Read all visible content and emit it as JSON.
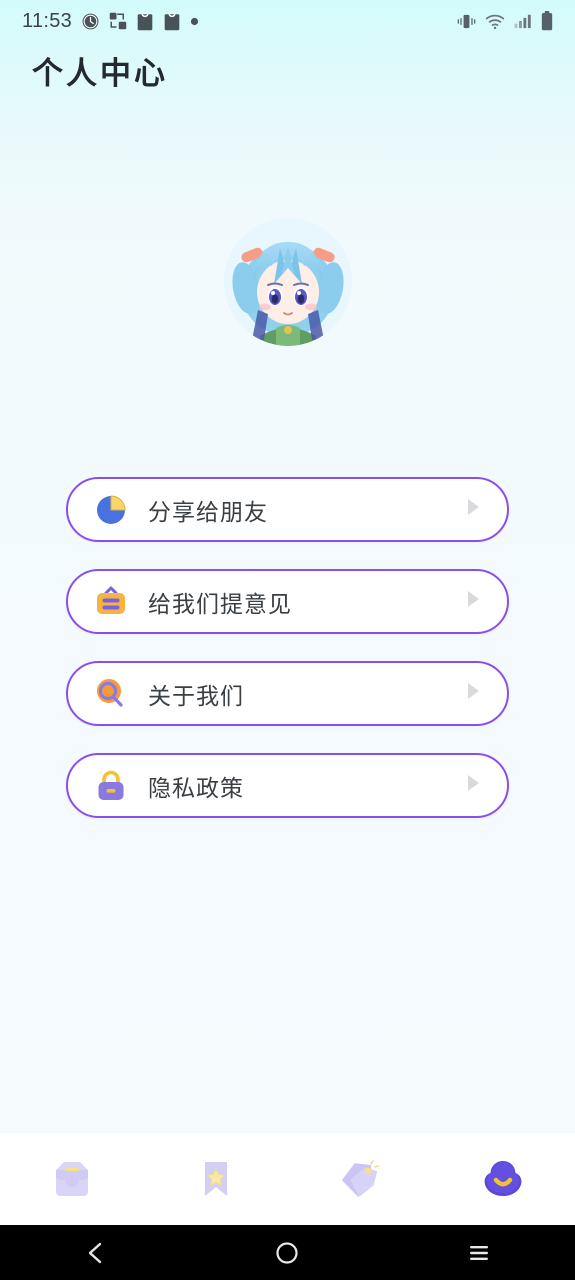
{
  "status_bar": {
    "time": "11:53",
    "left_icons": [
      "clock-icon",
      "share-nodes-icon",
      "shopping-bag-icon",
      "shopping-bag-icon",
      "dot-icon"
    ],
    "right_icons": [
      "vibrate-icon",
      "wifi-icon",
      "signal-bars-icon",
      "battery-icon"
    ]
  },
  "header": {
    "title": "个人中心"
  },
  "profile": {
    "avatar_alt": "用户头像",
    "avatar_icon": "anime-girl-avatar"
  },
  "menu": {
    "items": [
      {
        "label": "分享给朋友",
        "icon": "pie-share-icon",
        "arrow": "chevron-right-icon"
      },
      {
        "label": "给我们提意见",
        "icon": "feedback-board-icon",
        "arrow": "chevron-right-icon"
      },
      {
        "label": "关于我们",
        "icon": "magnifier-info-icon",
        "arrow": "chevron-right-icon"
      },
      {
        "label": "隐私政策",
        "icon": "lock-icon",
        "arrow": "chevron-right-icon"
      }
    ]
  },
  "tabbar": {
    "items": [
      {
        "name": "inbox-tab",
        "icon": "inbox-icon",
        "active": false
      },
      {
        "name": "favorites-tab",
        "icon": "bookmark-star-icon",
        "active": false
      },
      {
        "name": "tags-tab",
        "icon": "tags-icon",
        "active": false
      },
      {
        "name": "profile-tab",
        "icon": "cloud-face-icon",
        "active": true
      }
    ]
  },
  "system_nav": {
    "back": "back-icon",
    "home": "home-icon",
    "recents": "recents-icon"
  },
  "colors": {
    "accent_purple": "#8a4fe8",
    "tab_active": "#5a46d6",
    "tab_inactive": "#cfcbf5",
    "bg_top": "#d3fbfb",
    "bg_bottom": "#f5fbfd",
    "text_primary": "#3a3f44",
    "title": "#24292e"
  }
}
